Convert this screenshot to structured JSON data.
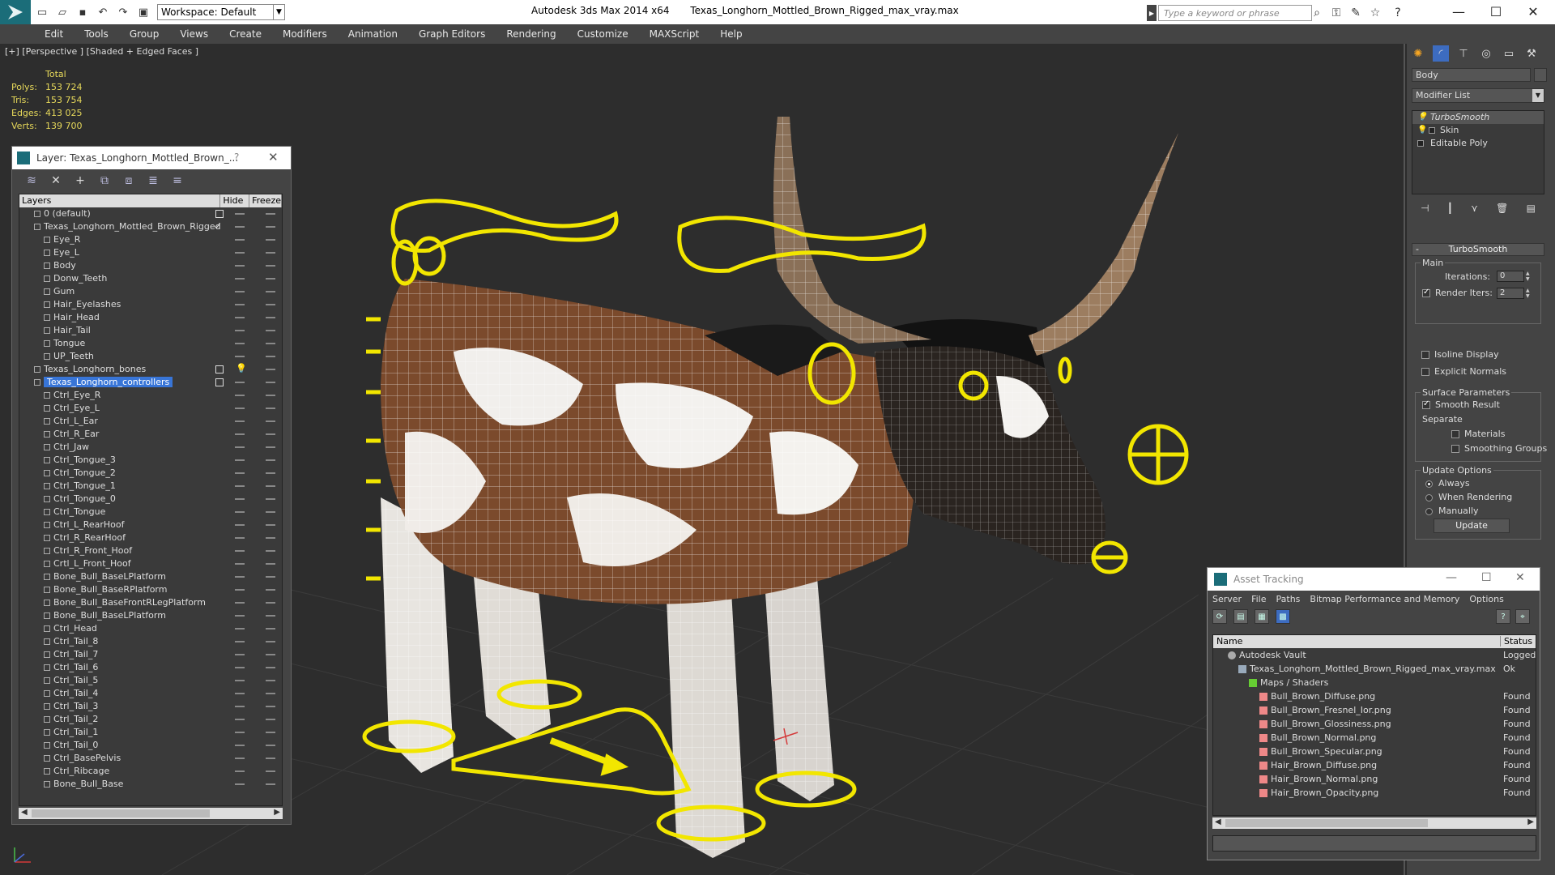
{
  "titlebar": {
    "workspace_label": "Workspace: Default",
    "app_name": "Autodesk 3ds Max  2014 x64",
    "file_name": "Texas_Longhorn_Mottled_Brown_Rigged_max_vray.max",
    "search_placeholder": "Type a keyword or phrase"
  },
  "menubar": {
    "items": [
      "Edit",
      "Tools",
      "Group",
      "Views",
      "Create",
      "Modifiers",
      "Animation",
      "Graph Editors",
      "Rendering",
      "Customize",
      "MAXScript",
      "Help"
    ]
  },
  "viewport": {
    "label": "[+] [Perspective ] [Shaded + Edged Faces ]",
    "stats": {
      "header": "Total",
      "rows": [
        {
          "key": "Polys:",
          "value": "153 724"
        },
        {
          "key": "Tris:",
          "value": "153 754"
        },
        {
          "key": "Edges:",
          "value": "413 025"
        },
        {
          "key": "Verts:",
          "value": "139 700"
        }
      ]
    }
  },
  "layer_dialog": {
    "title": "Layer: Texas_Longhorn_Mottled_Brown_...",
    "help": "?",
    "columns": {
      "layers": "Layers",
      "hide": "Hide",
      "freeze": "Freeze"
    },
    "rows": [
      {
        "name": "0 (default)",
        "level": 0,
        "type": "layer"
      },
      {
        "name": "Texas_Longhorn_Mottled_Brown_Rigged",
        "level": 0,
        "type": "layer",
        "expanded": true,
        "current": true
      },
      {
        "name": "Eye_R",
        "level": 1,
        "type": "object"
      },
      {
        "name": "Eye_L",
        "level": 1,
        "type": "object"
      },
      {
        "name": "Body",
        "level": 1,
        "type": "object"
      },
      {
        "name": "Donw_Teeth",
        "level": 1,
        "type": "object"
      },
      {
        "name": "Gum",
        "level": 1,
        "type": "object"
      },
      {
        "name": "Hair_Eyelashes",
        "level": 1,
        "type": "object"
      },
      {
        "name": "Hair_Head",
        "level": 1,
        "type": "object"
      },
      {
        "name": "Hair_Tail",
        "level": 1,
        "type": "object"
      },
      {
        "name": "Tongue",
        "level": 1,
        "type": "object"
      },
      {
        "name": "UP_Teeth",
        "level": 1,
        "type": "object"
      },
      {
        "name": "Texas_Longhorn_bones",
        "level": 0,
        "type": "layer",
        "hidden": true
      },
      {
        "name": "Texas_Longhorn_controllers",
        "level": 0,
        "type": "layer",
        "selected": true
      },
      {
        "name": "Ctrl_Eye_R",
        "level": 1,
        "type": "object"
      },
      {
        "name": "Ctrl_Eye_L",
        "level": 1,
        "type": "object"
      },
      {
        "name": "Ctrl_L_Ear",
        "level": 1,
        "type": "object"
      },
      {
        "name": "Ctrl_R_Ear",
        "level": 1,
        "type": "object"
      },
      {
        "name": "Ctrl_Jaw",
        "level": 1,
        "type": "object"
      },
      {
        "name": "Ctrl_Tongue_3",
        "level": 1,
        "type": "object"
      },
      {
        "name": "Ctrl_Tongue_2",
        "level": 1,
        "type": "object"
      },
      {
        "name": "Ctrl_Tongue_1",
        "level": 1,
        "type": "object"
      },
      {
        "name": "Ctrl_Tongue_0",
        "level": 1,
        "type": "object"
      },
      {
        "name": "Ctrl_Tongue",
        "level": 1,
        "type": "object"
      },
      {
        "name": "Ctrl_L_RearHoof",
        "level": 1,
        "type": "object"
      },
      {
        "name": "Ctrl_R_RearHoof",
        "level": 1,
        "type": "object"
      },
      {
        "name": "Ctrl_R_Front_Hoof",
        "level": 1,
        "type": "object"
      },
      {
        "name": "Crtl_L_Front_Hoof",
        "level": 1,
        "type": "object"
      },
      {
        "name": "Bone_Bull_BaseLPlatform",
        "level": 1,
        "type": "object"
      },
      {
        "name": "Bone_Bull_BaseRPlatform",
        "level": 1,
        "type": "object"
      },
      {
        "name": "Bone_Bull_BaseFrontRLegPlatform",
        "level": 1,
        "type": "object"
      },
      {
        "name": "Bone_Bull_BaseLPlatform",
        "level": 1,
        "type": "object"
      },
      {
        "name": "Ctrl_Head",
        "level": 1,
        "type": "object"
      },
      {
        "name": "Ctrl_Tail_8",
        "level": 1,
        "type": "object"
      },
      {
        "name": "Ctrl_Tail_7",
        "level": 1,
        "type": "object"
      },
      {
        "name": "Ctrl_Tail_6",
        "level": 1,
        "type": "object"
      },
      {
        "name": "Ctrl_Tail_5",
        "level": 1,
        "type": "object"
      },
      {
        "name": "Ctrl_Tail_4",
        "level": 1,
        "type": "object"
      },
      {
        "name": "Ctrl_Tail_3",
        "level": 1,
        "type": "object"
      },
      {
        "name": "Ctrl_Tail_2",
        "level": 1,
        "type": "object"
      },
      {
        "name": "Ctrl_Tail_1",
        "level": 1,
        "type": "object"
      },
      {
        "name": "Ctrl_Tail_0",
        "level": 1,
        "type": "object"
      },
      {
        "name": "Ctrl_BasePelvis",
        "level": 1,
        "type": "object"
      },
      {
        "name": "Ctrl_Ribcage",
        "level": 1,
        "type": "object"
      },
      {
        "name": "Bone_Bull_Base",
        "level": 1,
        "type": "object"
      }
    ]
  },
  "command_panel": {
    "object_name": "Body",
    "modifier_list_label": "Modifier List",
    "stack": [
      {
        "name": "TurboSmooth",
        "selected": true
      },
      {
        "name": "Skin"
      },
      {
        "name": "Editable Poly"
      }
    ],
    "turbosmooth": {
      "title": "TurboSmooth",
      "main_label": "Main",
      "iterations_label": "Iterations:",
      "iterations_value": "0",
      "render_iters_label": "Render Iters:",
      "render_iters_value": "2",
      "isoline_label": "Isoline Display",
      "explicit_normals_label": "Explicit Normals",
      "surface_label": "Surface Parameters",
      "smooth_result_label": "Smooth Result",
      "separate_label": "Separate",
      "materials_label": "Materials",
      "smoothing_groups_label": "Smoothing Groups",
      "update_options_label": "Update Options",
      "always_label": "Always",
      "when_rendering_label": "When Rendering",
      "manually_label": "Manually",
      "update_button": "Update"
    }
  },
  "asset_tracking": {
    "title": "Asset Tracking",
    "menu": [
      "Server",
      "File",
      "Paths",
      "Bitmap Performance and Memory",
      "Options"
    ],
    "columns": {
      "name": "Name",
      "status": "Status"
    },
    "rows": [
      {
        "name": "Autodesk Vault",
        "status": "Logged C",
        "indent": 0,
        "icon": "vault"
      },
      {
        "name": "Texas_Longhorn_Mottled_Brown_Rigged_max_vray.max",
        "status": "Ok",
        "indent": 1,
        "icon": "max"
      },
      {
        "name": "Maps / Shaders",
        "status": "",
        "indent": 2,
        "icon": "folder"
      },
      {
        "name": "Bull_Brown_Diffuse.png",
        "status": "Found",
        "indent": 3,
        "icon": "png"
      },
      {
        "name": "Bull_Brown_Fresnel_Ior.png",
        "status": "Found",
        "indent": 3,
        "icon": "png"
      },
      {
        "name": "Bull_Brown_Glossiness.png",
        "status": "Found",
        "indent": 3,
        "icon": "png"
      },
      {
        "name": "Bull_Brown_Normal.png",
        "status": "Found",
        "indent": 3,
        "icon": "png"
      },
      {
        "name": "Bull_Brown_Specular.png",
        "status": "Found",
        "indent": 3,
        "icon": "png"
      },
      {
        "name": "Hair_Brown_Diffuse.png",
        "status": "Found",
        "indent": 3,
        "icon": "png"
      },
      {
        "name": "Hair_Brown_Normal.png",
        "status": "Found",
        "indent": 3,
        "icon": "png"
      },
      {
        "name": "Hair_Brown_Opacity.png",
        "status": "Found",
        "indent": 3,
        "icon": "png"
      }
    ]
  },
  "colors": {
    "controller_yellow": "#f2e600",
    "stats_yellow": "#e6d85a",
    "selection_blue": "#3875d7",
    "app_teal": "#1b6d79"
  }
}
